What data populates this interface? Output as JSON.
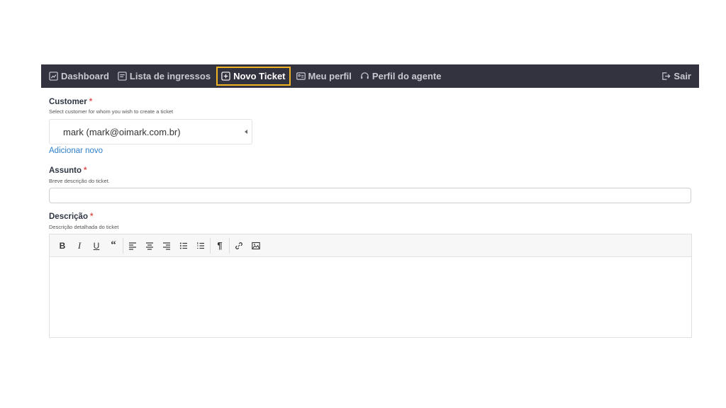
{
  "nav": {
    "items": [
      {
        "label": "Dashboard",
        "icon": "chart-icon",
        "active": false
      },
      {
        "label": "Lista de ingressos",
        "icon": "list-icon",
        "active": false
      },
      {
        "label": "Novo Ticket",
        "icon": "plus-square-icon",
        "active": true
      },
      {
        "label": "Meu perfil",
        "icon": "id-card-icon",
        "active": false
      },
      {
        "label": "Perfil do agente",
        "icon": "headset-icon",
        "active": false
      }
    ],
    "logout": {
      "label": "Sair",
      "icon": "logout-icon"
    },
    "colors": {
      "background": "#33323f",
      "active_border": "#f0b323",
      "text": "#c9c9d2"
    }
  },
  "form": {
    "customer": {
      "label": "Customer",
      "required_mark": "*",
      "help": "Select customer for whom you wish to create a ticket",
      "selected_value": "mark (mark@oimark.com.br)",
      "add_link": "Adicionar novo"
    },
    "subject": {
      "label": "Assunto",
      "required_mark": "*",
      "help": "Breve descrição do ticket.",
      "value": ""
    },
    "description": {
      "label": "Descrição",
      "required_mark": "*",
      "help": "Descrição detalhada do ticket",
      "toolbar": [
        "bold-icon",
        "italic-icon",
        "underline-icon",
        "blockquote-icon",
        "align-left-icon",
        "align-center-icon",
        "align-right-icon",
        "bullet-list-icon",
        "numbered-list-icon",
        "paragraph-icon",
        "link-icon",
        "image-icon"
      ]
    }
  },
  "colors": {
    "required": "#e05252",
    "link": "#2f7fc7"
  }
}
